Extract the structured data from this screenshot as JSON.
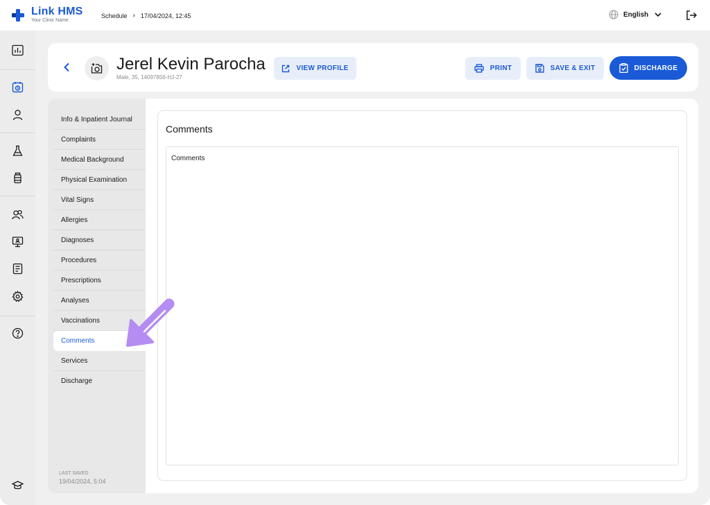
{
  "app": {
    "name": "Link HMS",
    "subtitle": "Your Clinic Name",
    "brand_color": "#1a5ad6"
  },
  "breadcrumb": {
    "section": "Schedule",
    "separator": "›",
    "datetime": "17/04/2024, 12:45"
  },
  "language": {
    "label": "English"
  },
  "rail": {
    "icons": [
      "dashboard-icon",
      "calendar-icon",
      "user-icon",
      "flask-icon",
      "medicine-bottle-icon",
      "users-icon",
      "monitor-icon",
      "report-icon",
      "settings-icon",
      "help-icon",
      "graduation-cap-icon"
    ]
  },
  "patient": {
    "name": "Jerel Kevin Parocha",
    "meta": "Male, 35, 14097856-HJ-27"
  },
  "actions": {
    "view_profile": "VIEW PROFILE",
    "print": "PRINT",
    "save_exit": "SAVE & EXIT",
    "discharge": "DISCHARGE"
  },
  "nav": {
    "items": [
      "Info & Inpatient Journal",
      "Complaints",
      "Medical Background",
      "Physical Examination",
      "Vital Signs",
      "Allergies",
      "Diagnoses",
      "Procedures",
      "Prescriptions",
      "Analyses",
      "Vaccinations",
      "Comments",
      "Services",
      "Discharge"
    ],
    "active": "Comments"
  },
  "last_saved": {
    "label": "LAST SAVED",
    "value": "19/04/2024, 5:04"
  },
  "content": {
    "title": "Comments",
    "field_placeholder": "Comments"
  },
  "colors": {
    "accent": "#1a5ad6",
    "pointer": "#b48cf2"
  }
}
